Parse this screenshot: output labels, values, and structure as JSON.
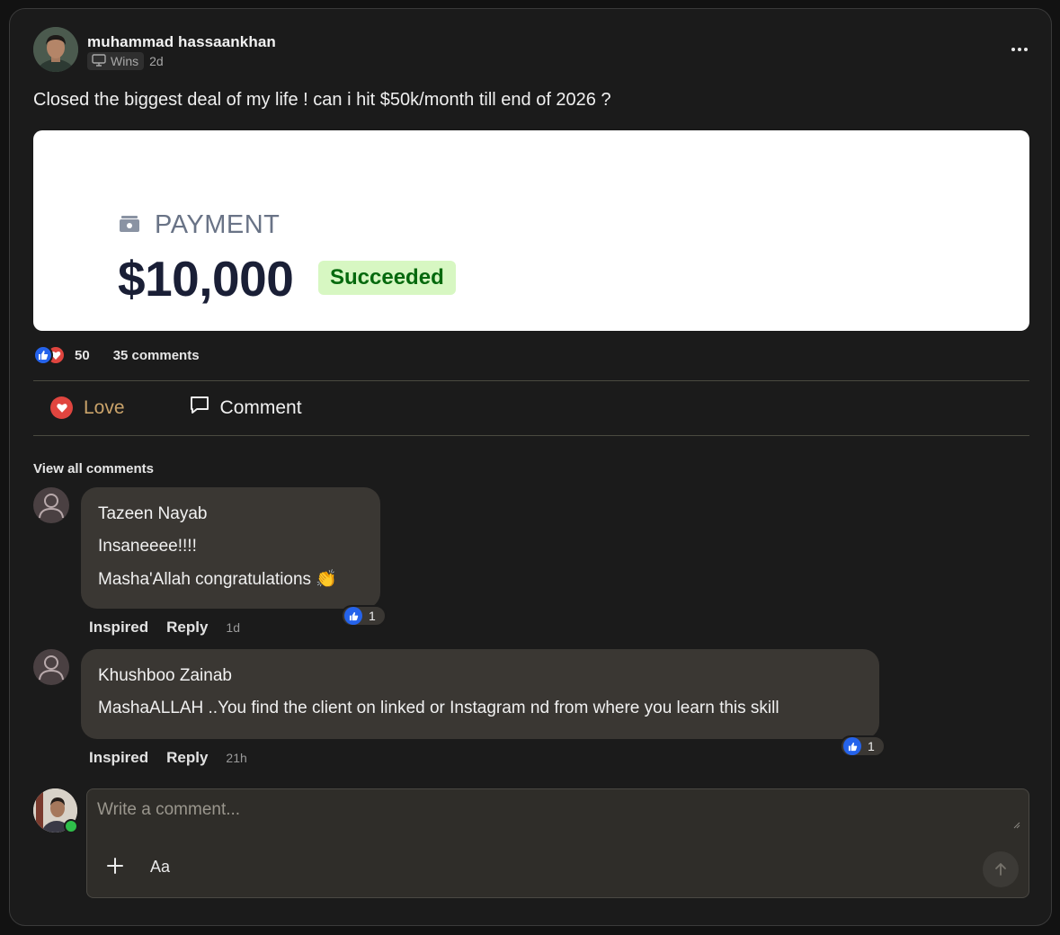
{
  "post": {
    "author": "muhammad hassaankhan",
    "category": "Wins",
    "time": "2d",
    "text": "Closed the biggest deal of my life ! can i hit $50k/month till end of 2026 ?"
  },
  "payment_image": {
    "label": "PAYMENT",
    "amount": "$10,000",
    "status": "Succeeded"
  },
  "stats": {
    "reactions": "50",
    "comments": "35 comments"
  },
  "actions": {
    "love": "Love",
    "comment": "Comment"
  },
  "view_all": "View all comments",
  "comments": [
    {
      "name": "Tazeen Nayab",
      "lines": [
        "Insaneeee!!!!",
        "Masha'Allah congratulations 👏"
      ],
      "inspired": "Inspired",
      "reply": "Reply",
      "time": "1d",
      "reactions": "1"
    },
    {
      "name": "Khushboo Zainab",
      "lines": [
        "MashaALLAH ..You find the client on linked or Instagram nd from where you learn this skill"
      ],
      "inspired": "Inspired",
      "reply": "Reply",
      "time": "21h",
      "reactions": "1"
    }
  ],
  "composer": {
    "placeholder": "Write a comment...",
    "format_label": "Aa"
  },
  "colors": {
    "background": "#1b1b1b",
    "like_blue": "#2563eb",
    "love_red": "#e0453f",
    "love_label": "#caa36a",
    "success_bg": "#d7f7c2",
    "success_text": "#05690d",
    "online_green": "#2fbf4a"
  },
  "icons": [
    "more-icon",
    "monitor-icon",
    "like-icon",
    "heart-icon",
    "comment-icon",
    "wallet-icon",
    "user-icon",
    "plus-icon",
    "send-arrow-icon"
  ]
}
